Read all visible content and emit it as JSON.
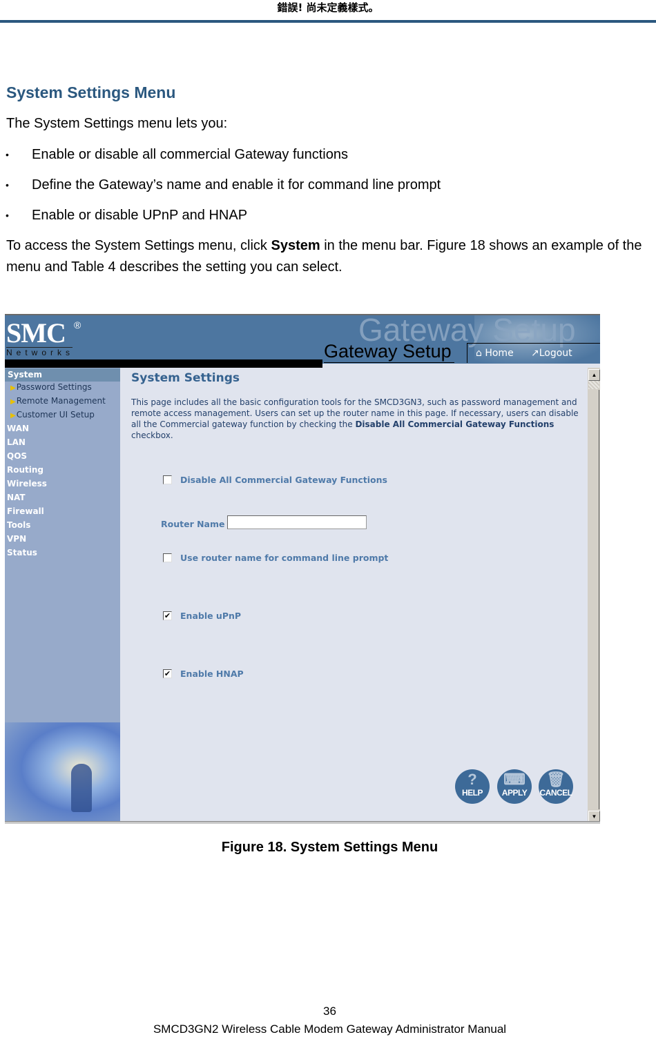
{
  "running_header": "錯誤! 尚未定義樣式。",
  "section": {
    "title": "System Settings Menu",
    "intro": "The System Settings menu lets you:",
    "bullets": [
      "Enable or disable all commercial Gateway functions",
      "Define the Gateway’s name and enable it for command line prompt",
      "Enable or disable UPnP and HNAP"
    ],
    "bullet_glyph": "•",
    "access_text_before": "To access the System Settings menu, click ",
    "access_bold": "System",
    "access_text_after": " in the menu bar. Figure 18 shows an example of the menu and Table 4 describes the setting you can select."
  },
  "screenshot": {
    "logo": {
      "brand": "SMC",
      "registered": "®",
      "sub": "Networks"
    },
    "watermark": "Gateway Setup",
    "app_title": "Gateway Setup",
    "nav": {
      "home": "Home",
      "home_icon": "⌂",
      "logout": "Logout",
      "logout_icon": "↗"
    },
    "sidebar": {
      "active": "System",
      "subitems": [
        "Password Settings",
        "Remote Management",
        "Customer UI Setup"
      ],
      "sub_arrow": "▶",
      "items": [
        "WAN",
        "LAN",
        "QOS",
        "Routing",
        "Wireless",
        "NAT",
        "Firewall",
        "Tools",
        "VPN",
        "Status"
      ]
    },
    "content": {
      "title": "System Settings",
      "desc_before": "This page includes all the basic configuration tools for the SMCD3GN3, such as password management and remote access management. Users can set up the router name in this page. If necessary, users can disable all the Commercial gateway function by checking the ",
      "desc_bold": "Disable All Commercial Gateway Functions",
      "desc_after": " checkbox.",
      "checkboxes": [
        {
          "label": "Disable All Commercial Gateway Functions",
          "checked": false
        },
        {
          "label": "Use router name for command line prompt",
          "checked": false
        },
        {
          "label": "Enable uPnP",
          "checked": true
        },
        {
          "label": "Enable HNAP",
          "checked": true
        }
      ],
      "check_glyph": "✔",
      "router_name_label": "Router Name :",
      "router_name_value": ""
    },
    "buttons": [
      {
        "label": "HELP",
        "glyph": "?"
      },
      {
        "label": "APPLY",
        "glyph": "⌨"
      },
      {
        "label": "CANCEL",
        "glyph": "🗑"
      }
    ],
    "scroll": {
      "up": "▲",
      "down": "▼"
    },
    "colors": {
      "banner": "#4d76a0",
      "sidebar": "#97aaca",
      "content_bg": "#e0e4ee",
      "accent": "#35628f"
    }
  },
  "caption": "Figure 18. System Settings Menu",
  "page_number": "36",
  "footer": "SMCD3GN2 Wireless Cable Modem Gateway Administrator Manual",
  "colors": {
    "heading": "#2b587f",
    "rule": "#2b587f"
  }
}
